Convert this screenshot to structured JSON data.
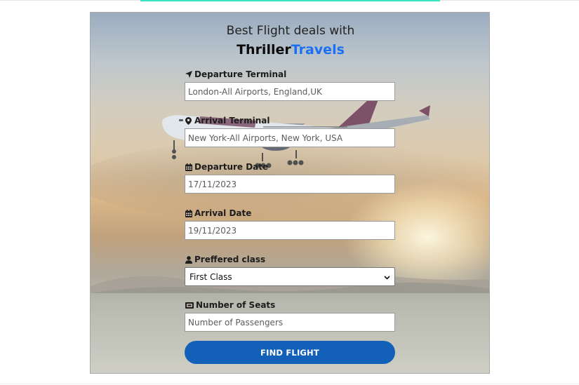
{
  "heading": {
    "line1": "Best Flight deals with",
    "brand_part1": "Thriller",
    "brand_part2": "Travels"
  },
  "form": {
    "departure_terminal": {
      "label": "Departure Terminal",
      "icon": "location-arrow-icon",
      "placeholder": "London-All Airports, England,UK"
    },
    "arrival_terminal": {
      "label": "Arrival Terminal",
      "icon": "map-pin-icon",
      "placeholder": "New York-All Airports, New York, USA"
    },
    "departure_date": {
      "label": "Departure Date",
      "icon": "calendar-icon",
      "placeholder": "17/11/2023"
    },
    "arrival_date": {
      "label": "Arrival Date",
      "icon": "calendar-icon",
      "placeholder": "19/11/2023"
    },
    "preferred_class": {
      "label": "Preffered class",
      "icon": "user-icon",
      "selected": "First Class"
    },
    "number_of_seats": {
      "label": "Number of Seats",
      "icon": "ticket-icon",
      "placeholder": "Number of Passengers"
    },
    "submit_label": "FIND FLIGHT"
  },
  "colors": {
    "brand_accent": "#1b6ff2",
    "button": "#1360b8",
    "top_accent": "#3ce3c3"
  }
}
